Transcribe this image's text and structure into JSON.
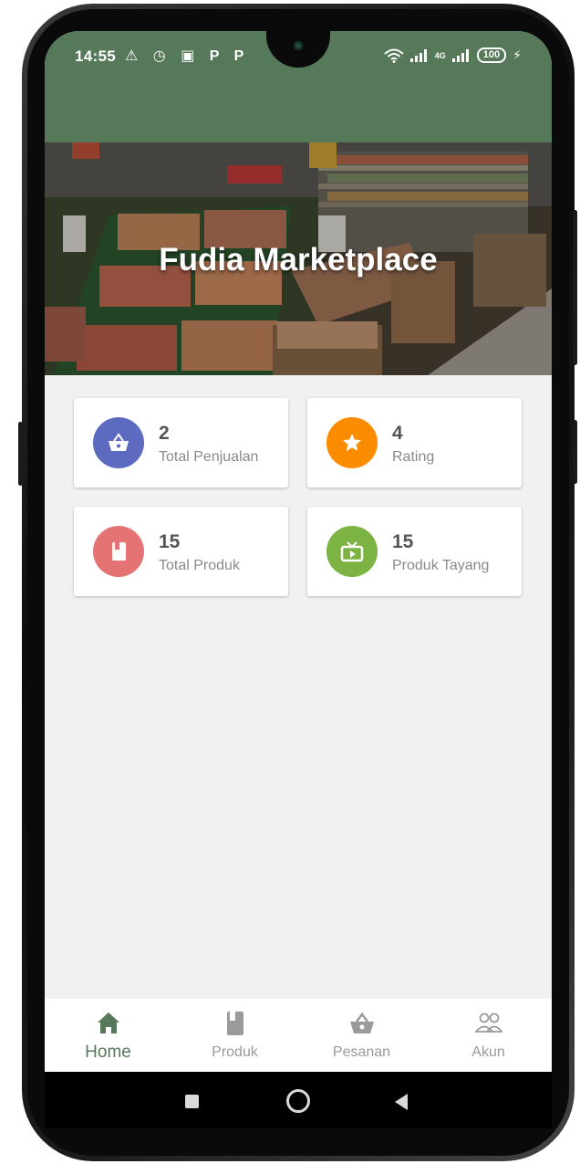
{
  "status_bar": {
    "time": "14:55",
    "left_icons": "⚠ ◷ ▣ P P",
    "signal_label": "4G",
    "battery": "100"
  },
  "hero": {
    "title": "Fudia Marketplace"
  },
  "stats": [
    {
      "value": "2",
      "label": "Total Penjualan",
      "color": "#5c6bc0",
      "icon": "basket-icon"
    },
    {
      "value": "4",
      "label": "Rating",
      "color": "#fb8c00",
      "icon": "star-icon"
    },
    {
      "value": "15",
      "label": "Total Produk",
      "color": "#e57373",
      "icon": "book-icon"
    },
    {
      "value": "15",
      "label": "Produk Tayang",
      "color": "#7cb342",
      "icon": "tv-icon"
    }
  ],
  "bottom_nav": [
    {
      "label": "Home",
      "icon": "home-icon",
      "active": true
    },
    {
      "label": "Produk",
      "icon": "book-icon",
      "active": false
    },
    {
      "label": "Pesanan",
      "icon": "basket-icon",
      "active": false
    },
    {
      "label": "Akun",
      "icon": "people-icon",
      "active": false
    }
  ],
  "colors": {
    "primary": "#56795a",
    "background": "#f1f1f1"
  }
}
